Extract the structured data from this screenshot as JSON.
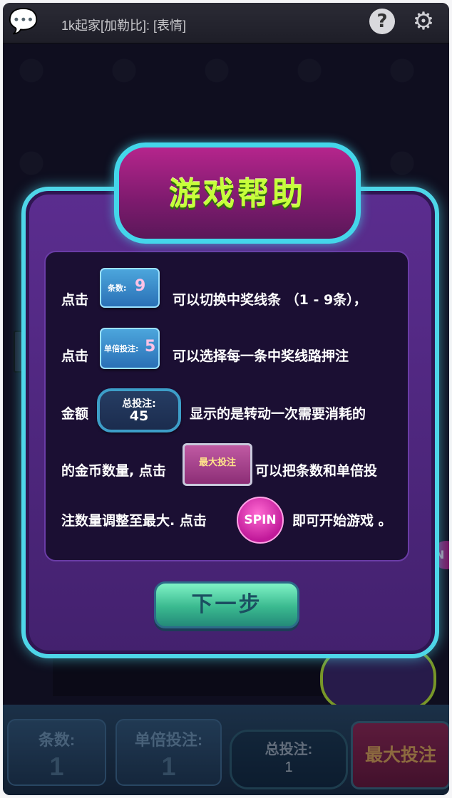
{
  "top_bar": {
    "chat_message": "1k起家[加勒比]: [表情]",
    "help_label": "?",
    "icons": [
      "chat-bubble-icon",
      "help-icon",
      "gear-icon"
    ]
  },
  "dialog": {
    "title": "游戏帮助",
    "line1": {
      "prefix": "点击",
      "suffix": "可以切换中奖线条  （1 - 9条），"
    },
    "line2": {
      "prefix": "点击",
      "suffix": "可以选择每一条中奖线路押注"
    },
    "line3": {
      "prefix": "金额",
      "suffix": "显示的是转动一次需要消耗的"
    },
    "line4": {
      "prefix": "的金币数量, 点击",
      "suffix": "可以把条数和单倍投"
    },
    "line5": {
      "prefix": "注数量调整至最大. 点击",
      "suffix": "即可开始游戏 。"
    },
    "chips": {
      "lines_label": "条数:",
      "lines_value": "9",
      "bet_label": "单倍投注:",
      "bet_value": "5",
      "total_label": "总投注:",
      "total_value": "45",
      "max_label": "最大投注",
      "spin_label": "SPIN"
    },
    "next_button": "下一步"
  },
  "bottom_bar": {
    "lines_label": "条数:",
    "lines_value": "1",
    "bet_label": "单倍投注:",
    "bet_value": "1",
    "total_label": "总投注:",
    "total_value": "1",
    "max_label": "最大投注",
    "spin_peek": "N"
  },
  "colors": {
    "dialog_border": "#4ed6e8",
    "dialog_fill": "#5b2d8f",
    "title_text": "#c6ff3a",
    "next_button": "#3ab98f",
    "spin_button": "#c11a9a"
  }
}
